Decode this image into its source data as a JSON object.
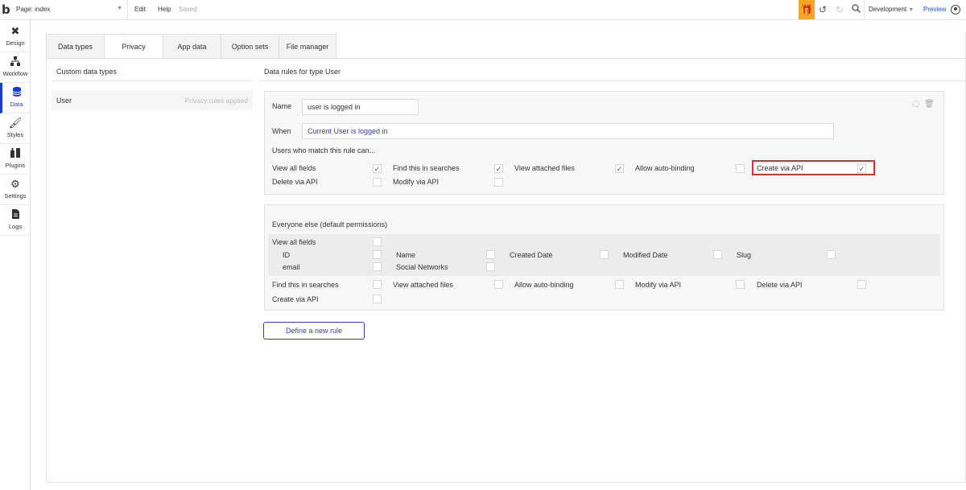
{
  "topbar": {
    "page_label": "Page: index",
    "edit": "Edit",
    "help": "Help",
    "saved": "Saved",
    "environment": "Development",
    "preview": "Preview"
  },
  "sidebar": {
    "items": [
      {
        "label": "Design",
        "icon": "design-tools-icon"
      },
      {
        "label": "Workflow",
        "icon": "workflow-icon"
      },
      {
        "label": "Data",
        "icon": "database-icon",
        "active": true
      },
      {
        "label": "Styles",
        "icon": "brush-icon"
      },
      {
        "label": "Plugins",
        "icon": "plugins-icon"
      },
      {
        "label": "Settings",
        "icon": "gear-icon"
      },
      {
        "label": "Logs",
        "icon": "logs-icon"
      }
    ]
  },
  "tabs": [
    "Data types",
    "Privacy",
    "App data",
    "Option sets",
    "File manager"
  ],
  "active_tab": "Privacy",
  "left": {
    "heading": "Custom data types",
    "type_name": "User",
    "type_status": "Privacy rules applied"
  },
  "right": {
    "heading": "Data rules for type User"
  },
  "rule": {
    "name_label": "Name",
    "name_value": "user is logged in",
    "when_label": "When",
    "when_value": "Current User is logged in",
    "match_label": "Users who match this rule can...",
    "perm_row1": [
      "View all fields",
      "Find this in searches",
      "View attached files",
      "Allow auto-binding",
      "Create via API"
    ],
    "perm_row2": [
      "Delete via API",
      "Modify via API"
    ]
  },
  "everyone": {
    "heading": "Everyone else (default permissions)",
    "view_all": "View all fields",
    "fields_row1": [
      "ID",
      "Name",
      "Created Date",
      "Modified Date",
      "Slug"
    ],
    "fields_row2": [
      "email",
      "Social Networks"
    ],
    "perm_row1": [
      "Find this in searches",
      "View attached files",
      "Allow auto-binding",
      "Modify via API",
      "Delete via API"
    ],
    "perm_row2": [
      "Create via API"
    ]
  },
  "define_button": "Define a new rule",
  "colors": {
    "accent": "#1a3bd1",
    "link": "#3b3bc4",
    "gift": "#f5a623",
    "highlight": "#d32f2f"
  }
}
